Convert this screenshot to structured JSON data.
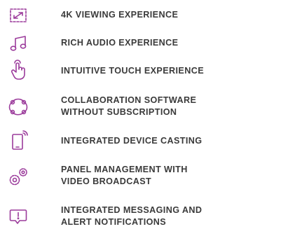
{
  "colors": {
    "accent": "#9b3b9b",
    "text": "#3a3a3a"
  },
  "features": [
    {
      "icon": "expand-arrows-icon",
      "lines": [
        "4K VIEWING EXPERIENCE"
      ]
    },
    {
      "icon": "music-note-icon",
      "lines": [
        "RICH AUDIO EXPERIENCE"
      ]
    },
    {
      "icon": "touch-hand-icon",
      "lines": [
        "INTUITIVE TOUCH EXPERIENCE"
      ]
    },
    {
      "icon": "collaboration-network-icon",
      "lines": [
        "COLLABORATION SOFTWARE",
        "WITHOUT SUBSCRIPTION"
      ]
    },
    {
      "icon": "device-casting-icon",
      "lines": [
        "INTEGRATED DEVICE CASTING"
      ]
    },
    {
      "icon": "gears-icon",
      "lines": [
        "PANEL MANAGEMENT WITH",
        "VIDEO BROADCAST"
      ]
    },
    {
      "icon": "alert-message-icon",
      "lines": [
        "INTEGRATED MESSAGING AND",
        "ALERT NOTIFICATIONS"
      ]
    }
  ]
}
